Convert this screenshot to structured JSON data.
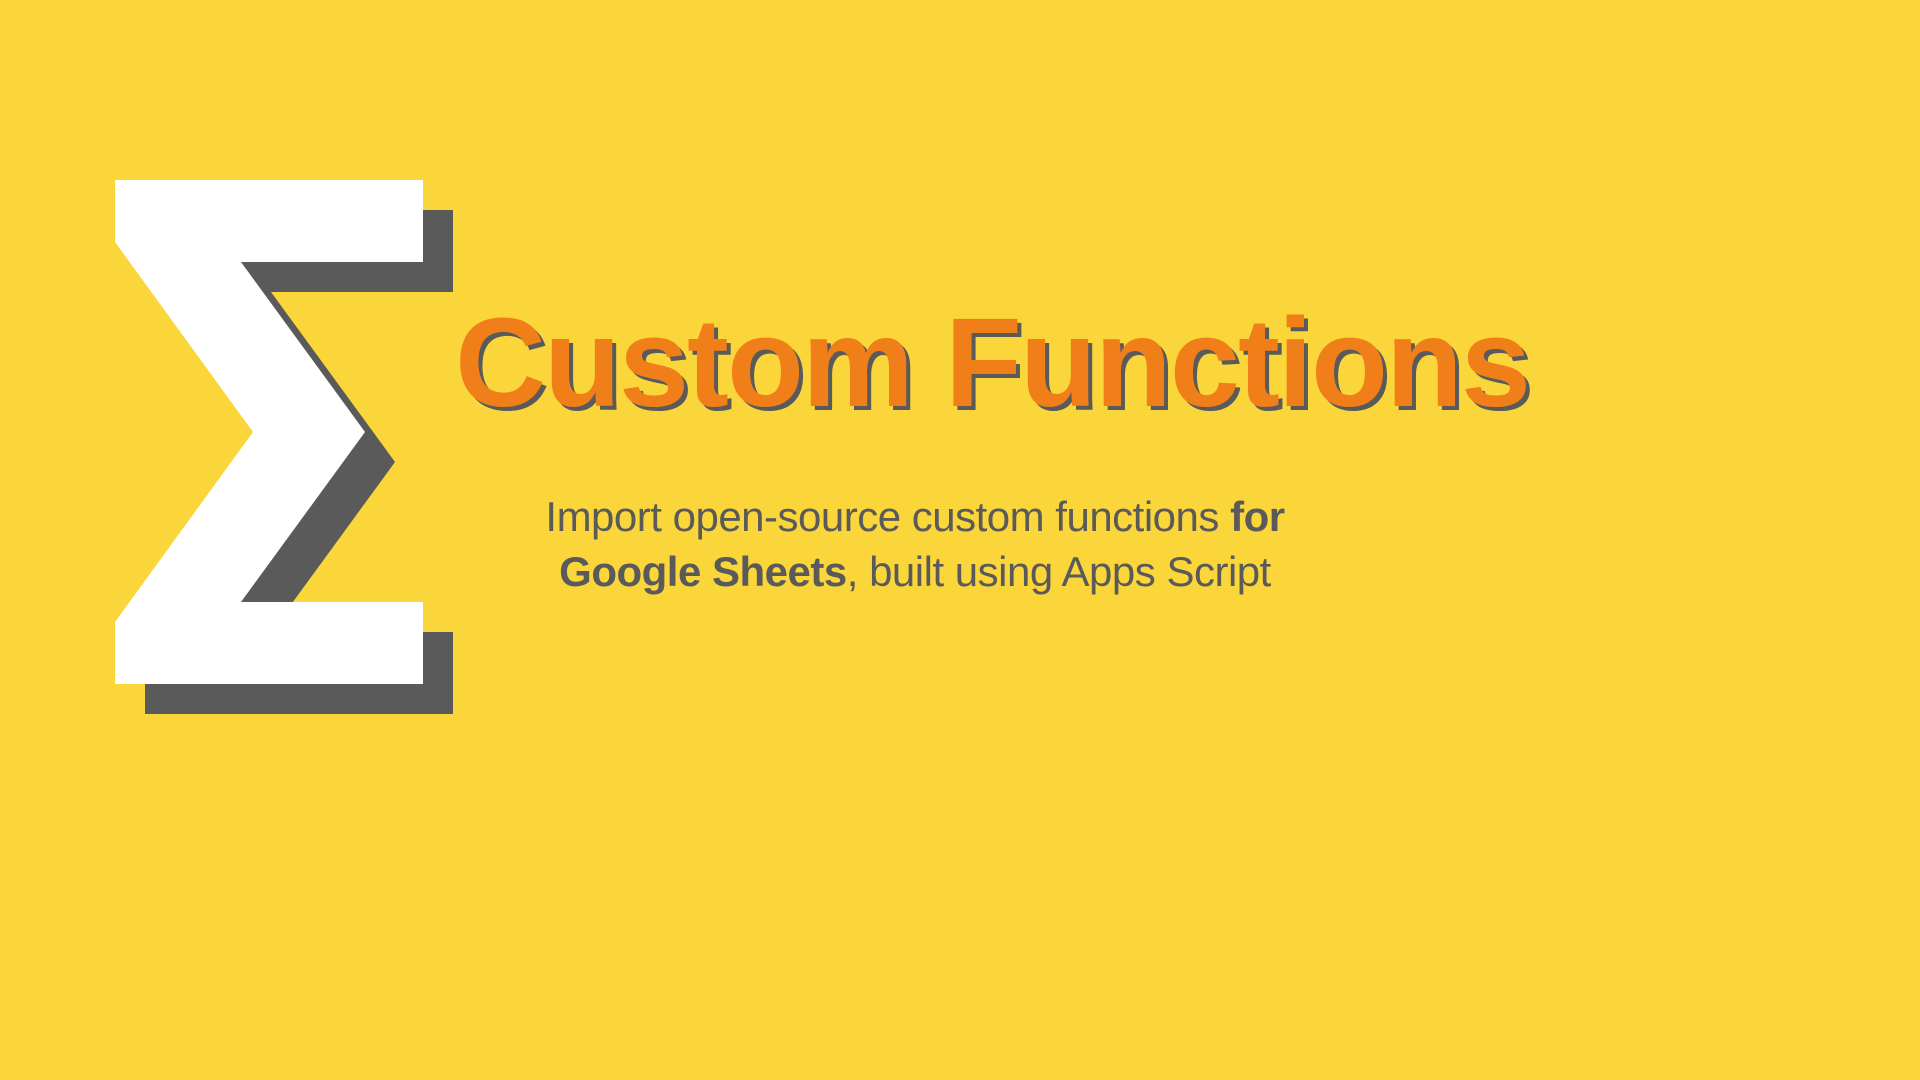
{
  "headline": "Custom Functions",
  "subtitle_pre": "Import open-source custom functions ",
  "subtitle_bold1": "for Google Sheets",
  "subtitle_post": ", built using Apps Script"
}
